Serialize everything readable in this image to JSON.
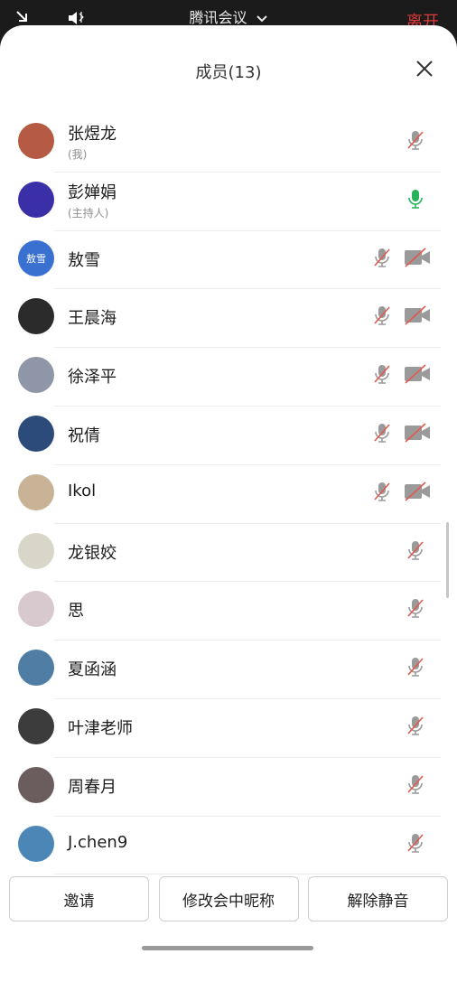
{
  "top_bar": {
    "title": "腾讯会议",
    "leave_label": "离开"
  },
  "sheet": {
    "title": "成员(13)"
  },
  "members": [
    {
      "name": "张煜龙",
      "sub": "(我)",
      "avatar_color": "#b55a45",
      "mic": "muted",
      "cam": "none"
    },
    {
      "name": "彭婵娟",
      "sub": "(主持人)",
      "avatar_color": "#3b2fa8",
      "mic": "active",
      "cam": "none"
    },
    {
      "name": "敖雪",
      "avatar_text": "敖雪",
      "avatar_color": "#3a71d1",
      "mic": "muted",
      "cam": "off"
    },
    {
      "name": "王晨海",
      "avatar_color": "#2b2b2b",
      "mic": "muted",
      "cam": "off"
    },
    {
      "name": "徐泽平",
      "avatar_color": "#8e96a7",
      "mic": "muted",
      "cam": "off"
    },
    {
      "name": "祝倩",
      "avatar_color": "#2c4b7a",
      "mic": "muted",
      "cam": "off"
    },
    {
      "name": "Ikol",
      "avatar_color": "#c8b397",
      "mic": "muted",
      "cam": "off"
    },
    {
      "name": "龙银姣",
      "avatar_color": "#d9d5c9",
      "mic": "muted",
      "cam": "none"
    },
    {
      "name": "思",
      "avatar_color": "#d8c9cf",
      "mic": "muted",
      "cam": "none"
    },
    {
      "name": "夏函涵",
      "avatar_color": "#4f7da4",
      "mic": "muted",
      "cam": "none"
    },
    {
      "name": "叶津老师",
      "avatar_color": "#3c3c3c",
      "mic": "muted",
      "cam": "none"
    },
    {
      "name": "周春月",
      "avatar_color": "#6b5d5e",
      "mic": "muted",
      "cam": "none"
    },
    {
      "name": "J.chen9",
      "avatar_color": "#4b86b7",
      "mic": "muted",
      "cam": "none"
    }
  ],
  "footer": {
    "invite": "邀请",
    "rename": "修改会中昵称",
    "unmute": "解除静音"
  },
  "colors": {
    "mic_active": "#27b35a",
    "muted_slash": "#e05a4f",
    "icon_gray": "#9a9a9a",
    "leave_red": "#e03a3a"
  }
}
